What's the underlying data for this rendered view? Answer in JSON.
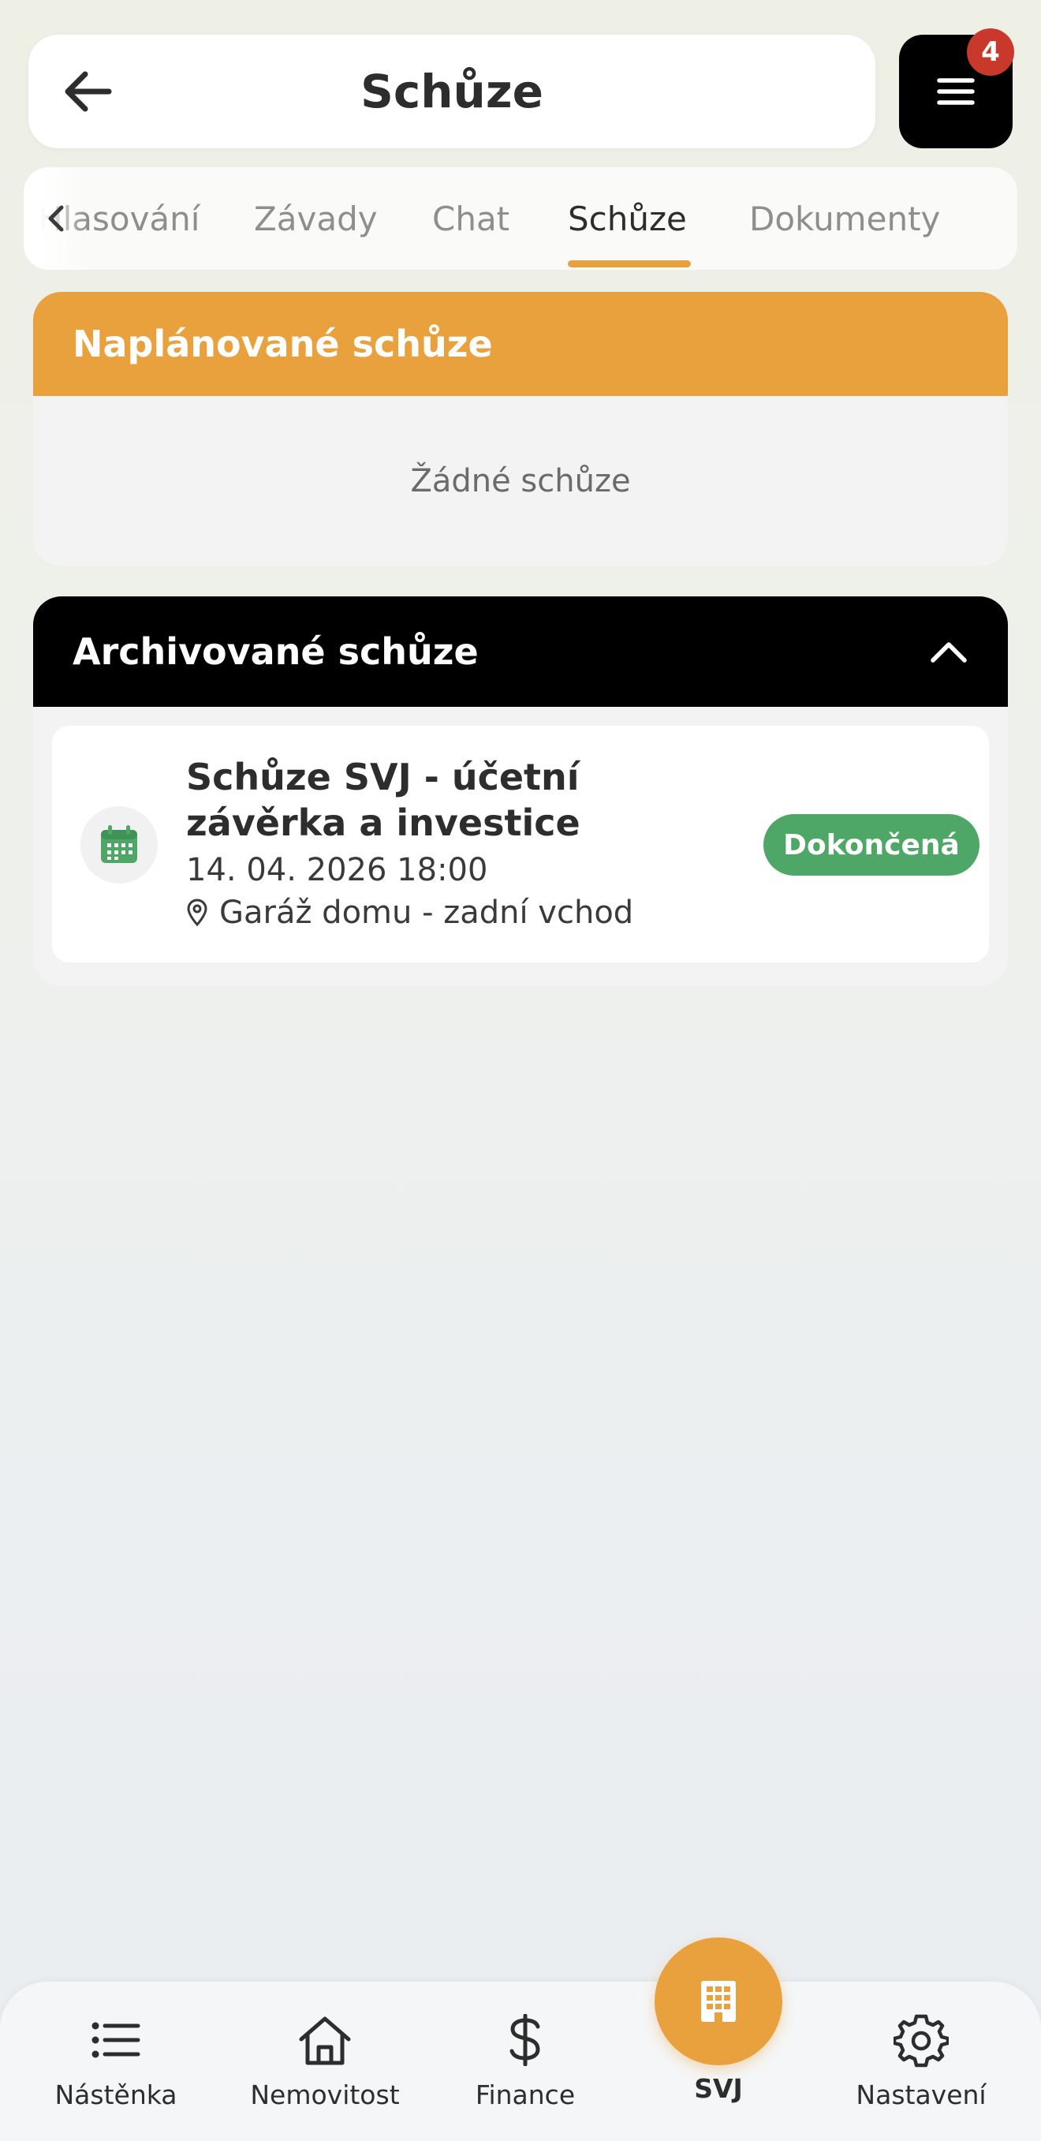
{
  "header": {
    "title": "Schůze",
    "notification_count": "4"
  },
  "tabs": [
    {
      "label": "Hlasování",
      "active": false
    },
    {
      "label": "Závady",
      "active": false
    },
    {
      "label": "Chat",
      "active": false
    },
    {
      "label": "Schůze",
      "active": true
    },
    {
      "label": "Dokumenty",
      "active": false
    }
  ],
  "planned": {
    "title": "Naplánované schůze",
    "empty_text": "Žádné schůze"
  },
  "archived": {
    "title": "Archivované schůze",
    "meetings": [
      {
        "title": "Schůze SVJ - účetní závěrka a investice",
        "datetime": "14. 04. 2026 18:00",
        "location": "Garáž domu - zadní vchod",
        "status": "Dokončená"
      }
    ]
  },
  "bottom_nav": {
    "items": [
      {
        "label": "Nástěnka",
        "icon": "list-icon"
      },
      {
        "label": "Nemovitost",
        "icon": "home-icon"
      },
      {
        "label": "Finance",
        "icon": "dollar-icon"
      },
      {
        "label": "SVJ",
        "icon": "building-icon",
        "active": true
      },
      {
        "label": "Nastavení",
        "icon": "gear-icon"
      }
    ]
  },
  "colors": {
    "accent": "#e9a13d",
    "badge": "#c9392b",
    "status_done": "#4ea767",
    "dark": "#000000"
  }
}
